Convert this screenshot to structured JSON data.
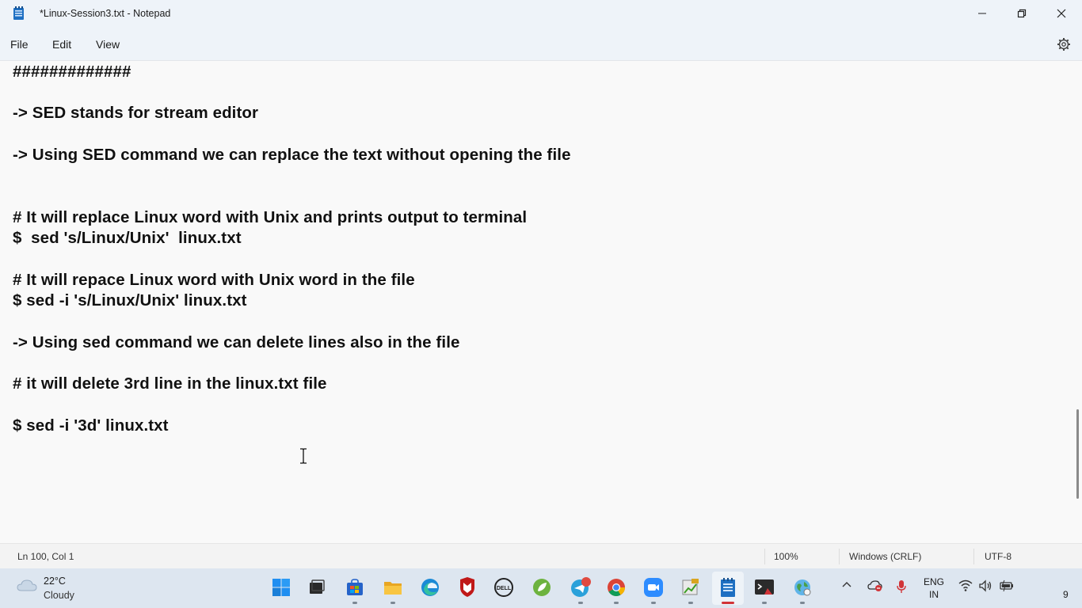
{
  "window": {
    "title": "*Linux-Session3.txt - Notepad",
    "controls": [
      "minimize-icon",
      "maximize-icon",
      "close-icon"
    ]
  },
  "menu": {
    "file": "File",
    "edit": "Edit",
    "view": "View",
    "settings_icon": "gear-icon"
  },
  "editor": {
    "lines": [
      "#############",
      "-> SED stands for stream editor",
      "-> Using SED command we can replace the text without opening the file",
      "# It will replace Linux word with Unix and prints output to terminal",
      "$  sed 's/Linux/Unix'  linux.txt",
      "# It will repace Linux word with Unix word in the file",
      "$ sed -i 's/Linux/Unix' linux.txt",
      "-> Using sed command we can delete lines also in the file",
      "# it will delete 3rd line in the linux.txt file",
      "$ sed -i '3d' linux.txt"
    ]
  },
  "status": {
    "position": "Ln 100, Col 1",
    "zoom": "100%",
    "line_ending": "Windows (CRLF)",
    "encoding": "UTF-8"
  },
  "taskbar": {
    "weather": {
      "temp": "22°C",
      "condition": "Cloudy",
      "icon": "cloud-icon"
    },
    "apps": [
      "start-icon",
      "task-view-icon",
      "store-icon",
      "file-explorer-icon",
      "edge-icon",
      "mcafee-icon",
      "dell-icon",
      "spring-icon",
      "telegram-icon",
      "chrome-icon",
      "zoom-icon",
      "sql-icon",
      "notepad-icon",
      "terminal-icon",
      "network-globe-icon"
    ],
    "tray": {
      "lang_top": "ENG",
      "lang_bottom": "IN",
      "clock_partial": "9"
    }
  }
}
